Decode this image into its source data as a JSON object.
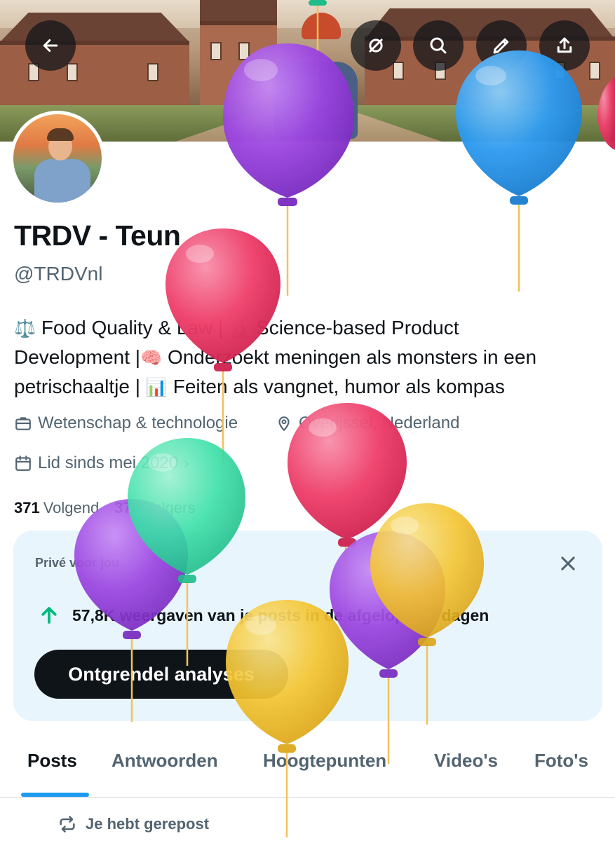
{
  "colors": {
    "accent": "#1d9bf0",
    "text_primary": "#0f1419",
    "text_secondary": "#536471",
    "card_bg": "#e8f5fd",
    "growth_green": "#00ba7c",
    "balloon_purple": "#9b45e0",
    "balloon_blue": "#2f9bf0",
    "balloon_pink": "#ee3f6a",
    "balloon_green": "#3be0a8",
    "balloon_yellow": "#f4c531"
  },
  "header": {
    "back_icon": "arrow-left-icon",
    "actions": [
      "mute-icon",
      "search-icon",
      "edit-icon",
      "share-icon"
    ]
  },
  "profile": {
    "display_name": "TRDV - Teun",
    "handle": "@TRDVnl",
    "bio": {
      "line1_emoji": "⚖️",
      "line1_a": "Food Quality & Law | ",
      "line1_emoji2": "🔬",
      "line1_b": " Science-based Product",
      "line2_a": "Development |",
      "line2_emoji": "🧠",
      "line2_b": " Onderzoekt meningen als monsters in een",
      "line3_a": "petrischaaltje | ",
      "line3_emoji": "📊",
      "line3_b": " Feiten als vangnet, humor als kompas"
    },
    "category": "Wetenschap & technologie",
    "location": "Overijssel, Nederland",
    "joined": "Lid sinds mei 2020",
    "following_count": "371",
    "following_label": "Volgend",
    "followers_count": "375",
    "followers_label": "Volgers"
  },
  "private_card": {
    "label": "Privé voor jou",
    "stat_text": "57,8K weergaven van je posts in de afgelopen 7 dagen",
    "cta": "Ontgrendel analyses"
  },
  "tabs": [
    {
      "label": "Posts"
    },
    {
      "label": "Antwoorden"
    },
    {
      "label": "Hoogtepunten"
    },
    {
      "label": "Video's"
    },
    {
      "label": "Foto's"
    }
  ],
  "feed": {
    "repost_label": "Je hebt gerepost"
  }
}
